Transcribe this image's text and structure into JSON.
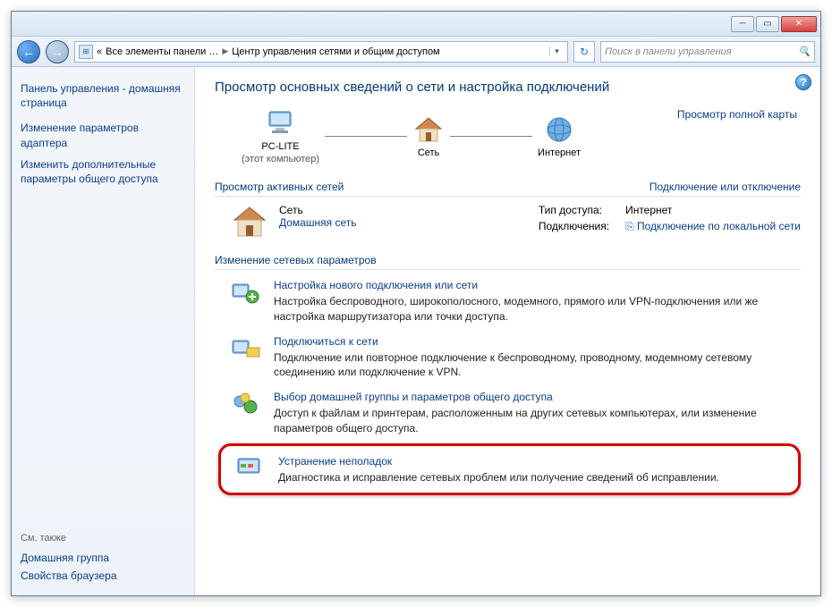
{
  "breadcrumb": {
    "first": "Все элементы панели …",
    "current": "Центр управления сетями и общим доступом"
  },
  "search": {
    "placeholder": "Поиск в панели управления"
  },
  "sidebar": {
    "home": "Панель управления - домашняя страница",
    "links": [
      "Изменение параметров адаптера",
      "Изменить дополнительные параметры общего доступа"
    ],
    "see_also_label": "См. также",
    "see_also": [
      "Домашняя группа",
      "Свойства браузера"
    ]
  },
  "main": {
    "heading": "Просмотр основных сведений о сети и настройка подключений",
    "fullmap_link": "Просмотр полной карты",
    "nodes": {
      "pc": "PC-LITE",
      "pc_sub": "(этот компьютер)",
      "net": "Сеть",
      "internet": "Интернет"
    },
    "active_section_left": "Просмотр активных сетей",
    "active_section_right": "Подключение или отключение",
    "active_net": {
      "name": "Сеть",
      "type": "Домашняя сеть",
      "access_type_label": "Тип доступа:",
      "access_type_value": "Интернет",
      "connections_label": "Подключения:",
      "connections_value": "Подключение по локальной сети"
    },
    "change_section": "Изменение сетевых параметров",
    "options": [
      {
        "title": "Настройка нового подключения или сети",
        "desc": "Настройка беспроводного, широкополосного, модемного, прямого или VPN-подключения или же настройка маршрутизатора или точки доступа."
      },
      {
        "title": "Подключиться к сети",
        "desc": "Подключение или повторное подключение к беспроводному, проводному, модемному сетевому соединению или подключение к VPN."
      },
      {
        "title": "Выбор домашней группы и параметров общего доступа",
        "desc": "Доступ к файлам и принтерам, расположенным на других сетевых компьютерах, или изменение параметров общего доступа."
      },
      {
        "title": "Устранение неполадок",
        "desc": "Диагностика и исправление сетевых проблем или получение сведений об исправлении."
      }
    ]
  }
}
